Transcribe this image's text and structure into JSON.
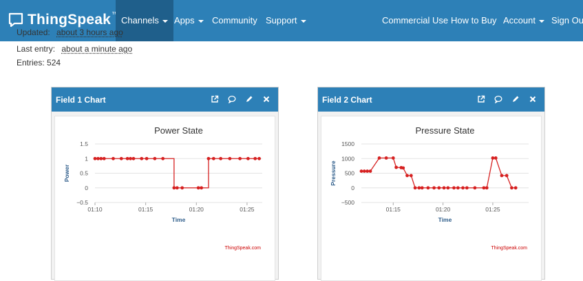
{
  "brand": {
    "name": "ThingSpeak",
    "tm": "™"
  },
  "nav": {
    "left": [
      {
        "label": "Channels",
        "caret": true,
        "active": true
      },
      {
        "label": "Apps",
        "caret": true
      },
      {
        "label": "Community",
        "caret": false
      },
      {
        "label": "Support",
        "caret": true
      }
    ],
    "right": [
      {
        "label": "Commercial Use",
        "caret": false
      },
      {
        "label": "How to Buy",
        "caret": false
      },
      {
        "label": "Account",
        "caret": true
      },
      {
        "label": "Sign Out",
        "caret": false
      }
    ]
  },
  "channel_info": {
    "updated_label": "Updated:",
    "updated_value": "about 3 hours ago",
    "last_entry_label": "Last entry:",
    "last_entry_value": "about a minute ago",
    "entries_text": "Entries: 524"
  },
  "panels": [
    {
      "title": "Field 1 Chart",
      "icons": [
        "external-link-icon",
        "comment-icon",
        "pencil-icon",
        "close-icon"
      ],
      "chart_data": {
        "type": "line",
        "title": "Power State",
        "xlabel": "Time",
        "ylabel": "Power",
        "credit": "ThingSpeak.com",
        "color": "#d62020",
        "step": true,
        "ylim": [
          -0.5,
          1.5
        ],
        "yticks": [
          -0.5,
          0,
          0.5,
          1,
          1.5
        ],
        "ytick_labels": [
          "−0.5",
          "0",
          "0.5",
          "1",
          "1.5"
        ],
        "xlim": [
          0.0,
          16.5
        ],
        "xticks": [
          0,
          5,
          10,
          15
        ],
        "xtick_labels": [
          "01:10",
          "01:15",
          "01:20",
          "01:25"
        ],
        "x": [
          0,
          0.3,
          0.6,
          0.9,
          1.8,
          2.6,
          3.2,
          3.5,
          3.8,
          4.6,
          5.1,
          5.9,
          6.7,
          7.8,
          8.1,
          8.6,
          10.2,
          10.5,
          11.2,
          11.7,
          12.4,
          13.3,
          14.3,
          15.1,
          15.8,
          16.2
        ],
        "y": [
          1,
          1,
          1,
          1,
          1,
          1,
          1,
          1,
          1,
          1,
          1,
          1,
          1,
          0,
          0,
          0,
          0,
          0,
          1,
          1,
          1,
          1,
          1,
          1,
          1,
          1
        ]
      }
    },
    {
      "title": "Field 2 Chart",
      "icons": [
        "external-link-icon",
        "comment-icon",
        "pencil-icon",
        "close-icon"
      ],
      "chart_data": {
        "type": "line",
        "title": "Pressure State",
        "xlabel": "Time",
        "ylabel": "Pressure",
        "credit": "ThingSpeak.com",
        "color": "#d62020",
        "step": false,
        "ylim": [
          -500,
          1500
        ],
        "yticks": [
          -500,
          0,
          500,
          1000,
          1500
        ],
        "ytick_labels": [
          "−500",
          "0",
          "500",
          "1000",
          "1500"
        ],
        "xlim": [
          0.0,
          16.8
        ],
        "xticks": [
          3.2,
          8.2,
          13.2
        ],
        "xtick_labels": [
          "01:15",
          "01:20",
          "01:25"
        ],
        "x": [
          0,
          0.3,
          0.6,
          0.9,
          1.8,
          2.5,
          3.2,
          3.5,
          4.0,
          4.2,
          4.6,
          5.0,
          5.4,
          5.8,
          6.1,
          6.7,
          7.3,
          7.8,
          8.3,
          8.7,
          9.3,
          9.7,
          10.2,
          10.6,
          11.4,
          12.3,
          12.6,
          13.2,
          13.5,
          14.1,
          14.6,
          15.1,
          15.5
        ],
        "y": [
          570,
          570,
          570,
          570,
          1020,
          1020,
          1020,
          700,
          690,
          680,
          420,
          420,
          0,
          0,
          0,
          0,
          0,
          0,
          0,
          0,
          0,
          0,
          0,
          0,
          0,
          0,
          0,
          1020,
          1020,
          420,
          420,
          0,
          0
        ]
      }
    }
  ]
}
